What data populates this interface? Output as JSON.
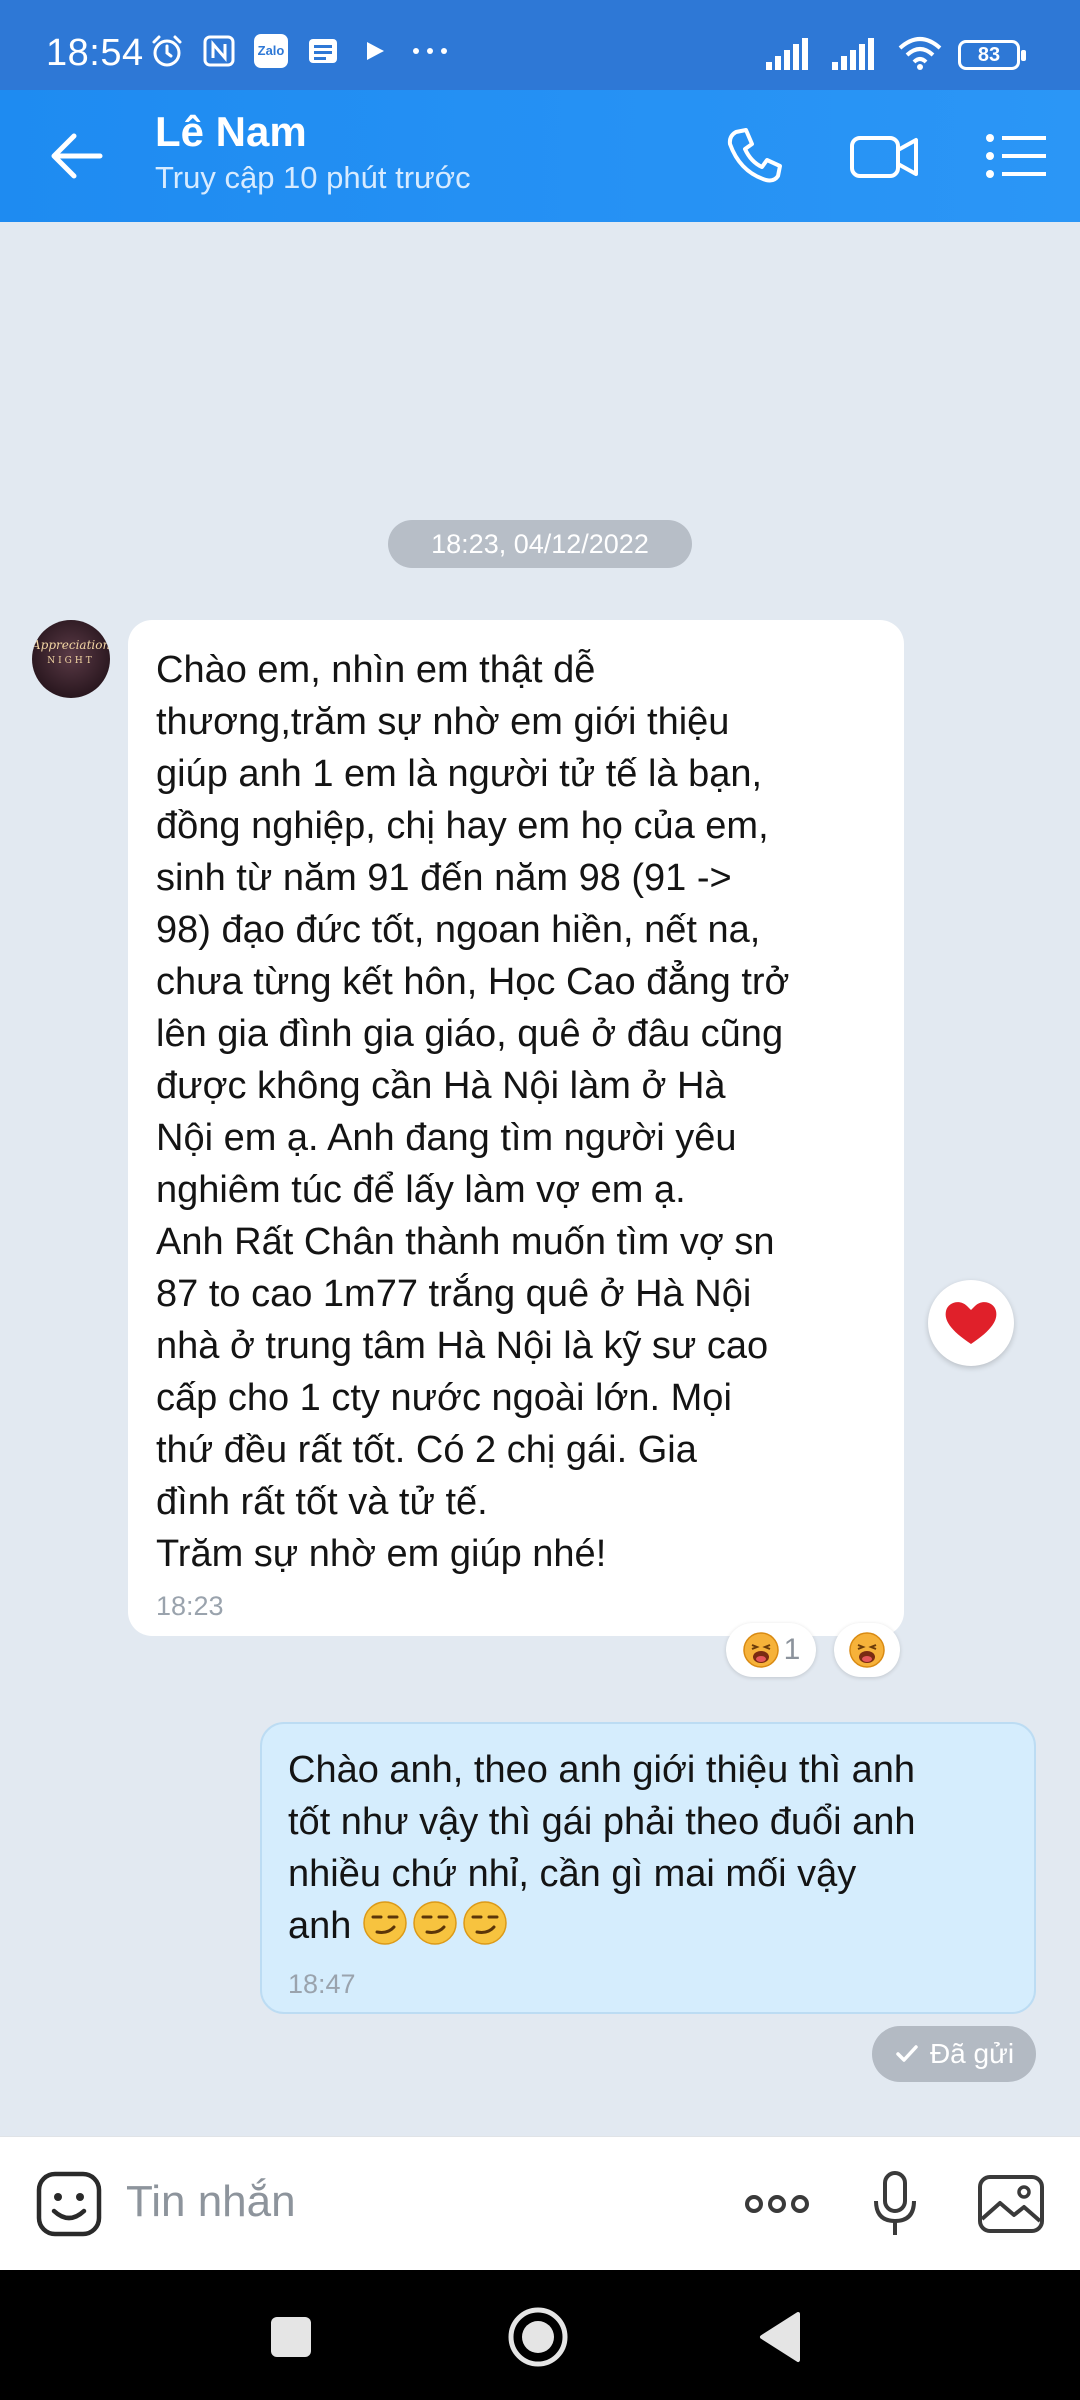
{
  "status_bar": {
    "time": "18:54",
    "battery": "83",
    "left_icons": [
      "alarm-icon",
      "nfc-icon",
      "zalo-icon",
      "message-icon",
      "play-icon",
      "more-dots-icon"
    ],
    "zalo_text": "Zalo",
    "right_icons": [
      "signal-icon",
      "signal-icon",
      "wifi-icon",
      "battery-icon"
    ]
  },
  "header": {
    "contact_name": "Lê Nam",
    "contact_status": "Truy cập 10 phút trước",
    "icons": [
      "back-arrow-icon",
      "phone-icon",
      "video-call-icon",
      "menu-list-icon"
    ],
    "accent_color": "#1e8bf1"
  },
  "chat": {
    "date_chip": "18:23, 04/12/2022",
    "avatar_text": "Appreciation",
    "avatar_sub": "NIGHT",
    "incoming": {
      "text": "Chào em, nhìn em thật dễ\nthương,trăm sự nhờ em giới thiệu\ngiúp anh 1 em là người tử tế là bạn,\nđồng nghiệp, chị hay em họ của em,\nsinh từ năm 91 đến năm 98 (91 ->\n98)  đạo đức tốt,  ngoan hiền, nết na,\nchưa từng kết hôn, Học Cao đẳng trở\nlên gia đình gia giáo, quê ở đâu cũng\nđược không cần Hà Nội làm ở Hà\nNội em ạ. Anh đang tìm người yêu\nnghiêm túc để lấy làm vợ em ạ.\nAnh Rất Chân thành muốn tìm vợ sn\n87 to cao 1m77 trắng quê ở Hà Nội\nnhà ở trung tâm Hà Nội là kỹ sư cao\ncấp cho 1 cty nước ngoài lớn. Mọi\nthứ đều rất tốt. Có 2 chị gái.  Gia\nđình rất tốt và tử tế.\nTrăm sự nhờ em giúp nhé!",
      "time": "18:23",
      "reaction_count": "1",
      "reaction_icon": "laughing-face-icon",
      "heart_icon": "heart-icon"
    },
    "outgoing": {
      "text": "Chào anh, theo anh giới thiệu thì anh\ntốt như vậy thì gái phải theo đuổi anh\nnhiều chứ nhỉ, cần gì mai mối vậy\nanh ",
      "emojis": [
        "smirk-face-icon",
        "smirk-face-icon",
        "smirk-face-icon"
      ],
      "time": "18:47",
      "status": "Đã gửi"
    }
  },
  "input_bar": {
    "placeholder": "Tin nhắn",
    "icons": [
      "sticker-icon",
      "more-horizontal-icon",
      "microphone-icon",
      "image-icon"
    ]
  },
  "nav_bar": {
    "icons": [
      "recents-square-icon",
      "home-circle-icon",
      "back-triangle-icon"
    ]
  }
}
